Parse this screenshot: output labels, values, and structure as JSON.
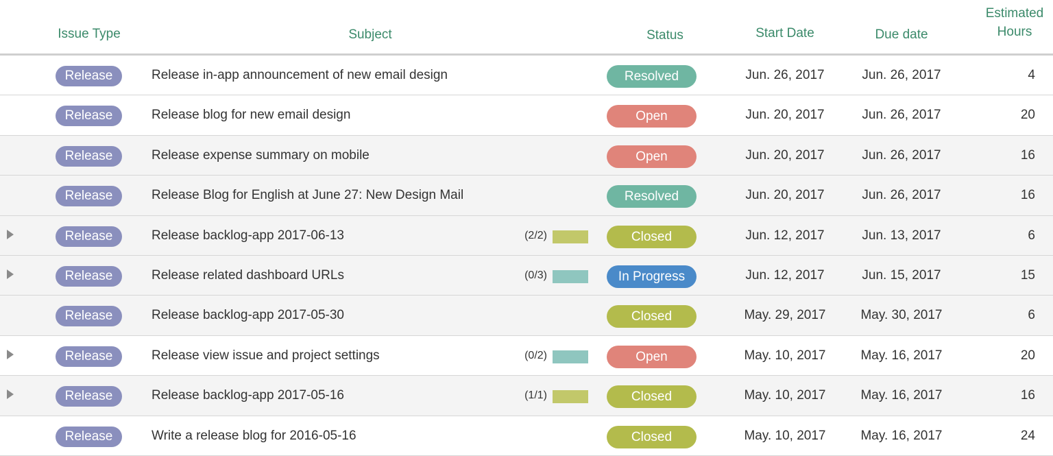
{
  "header": {
    "issue_type": "Issue Type",
    "subject": "Subject",
    "status": "Status",
    "start_date": "Start Date",
    "due_date": "Due date",
    "estimated_hours_line1": "Estimated",
    "estimated_hours_line2": "Hours"
  },
  "colors": {
    "header_text": "#3b8a6a",
    "type_badge": "#8a8fbd",
    "status_resolved": "#6fb6a2",
    "status_open": "#e0847a",
    "status_closed": "#b3bb4c",
    "status_in_progress": "#4a8ac9",
    "progress_complete": "#c2c86a",
    "progress_incomplete": "#8fc6bf"
  },
  "rows": [
    {
      "has_children": false,
      "type": "Release",
      "subject": "Release in-app announcement of new email design",
      "progress": "",
      "progress_fraction": null,
      "status": "Resolved",
      "status_key": "resolved",
      "start": "Jun. 26, 2017",
      "due": "Jun. 26, 2017",
      "hours": "4"
    },
    {
      "has_children": false,
      "type": "Release",
      "subject": "Release blog for new email design",
      "progress": "",
      "progress_fraction": null,
      "status": "Open",
      "status_key": "open",
      "start": "Jun. 20, 2017",
      "due": "Jun. 26, 2017",
      "hours": "20"
    },
    {
      "has_children": false,
      "type": "Release",
      "subject": "Release expense summary on mobile",
      "progress": "",
      "progress_fraction": null,
      "status": "Open",
      "status_key": "open",
      "start": "Jun. 20, 2017",
      "due": "Jun. 26, 2017",
      "hours": "16"
    },
    {
      "has_children": false,
      "type": "Release",
      "subject": "Release Blog for English at June 27: New Design Mail",
      "progress": "",
      "progress_fraction": null,
      "status": "Resolved",
      "status_key": "resolved",
      "start": "Jun. 20, 2017",
      "due": "Jun. 26, 2017",
      "hours": "16"
    },
    {
      "has_children": true,
      "type": "Release",
      "subject": "Release backlog-app 2017-06-13",
      "progress": "(2/2)",
      "progress_fraction": 1,
      "status": "Closed",
      "status_key": "closed",
      "start": "Jun. 12, 2017",
      "due": "Jun. 13, 2017",
      "hours": "6"
    },
    {
      "has_children": true,
      "type": "Release",
      "subject": "Release related dashboard URLs",
      "progress": "(0/3)",
      "progress_fraction": 0,
      "status": "In Progress",
      "status_key": "in_progress",
      "start": "Jun. 12, 2017",
      "due": "Jun. 15, 2017",
      "hours": "15"
    },
    {
      "has_children": false,
      "type": "Release",
      "subject": "Release backlog-app 2017-05-30",
      "progress": "",
      "progress_fraction": null,
      "status": "Closed",
      "status_key": "closed",
      "start": "May. 29, 2017",
      "due": "May. 30, 2017",
      "hours": "6"
    },
    {
      "has_children": true,
      "type": "Release",
      "subject": "Release view issue and project settings",
      "progress": "(0/2)",
      "progress_fraction": 0,
      "status": "Open",
      "status_key": "open",
      "start": "May. 10, 2017",
      "due": "May. 16, 2017",
      "hours": "20"
    },
    {
      "has_children": true,
      "type": "Release",
      "subject": "Release backlog-app 2017-05-16",
      "progress": "(1/1)",
      "progress_fraction": 1,
      "status": "Closed",
      "status_key": "closed",
      "start": "May. 10, 2017",
      "due": "May. 16, 2017",
      "hours": "16"
    },
    {
      "has_children": false,
      "type": "Release",
      "subject": "Write a release blog for 2016-05-16",
      "progress": "",
      "progress_fraction": null,
      "status": "Closed",
      "status_key": "closed",
      "start": "May. 10, 2017",
      "due": "May. 16, 2017",
      "hours": "24"
    }
  ]
}
